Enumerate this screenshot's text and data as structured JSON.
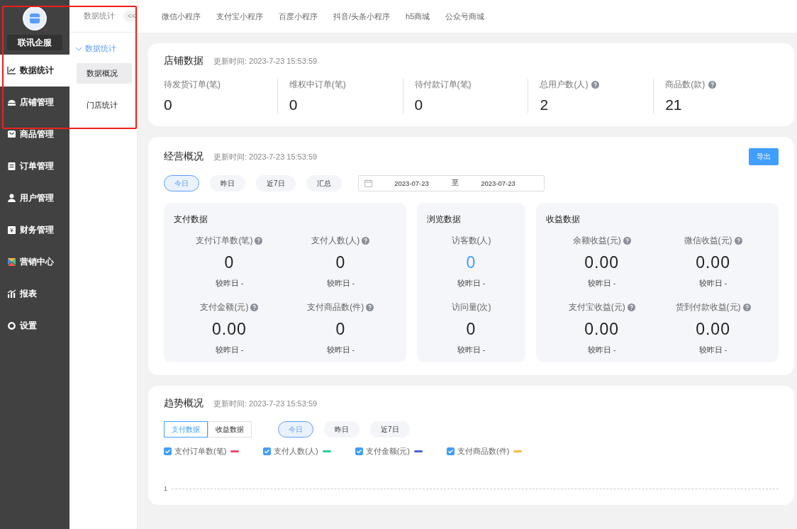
{
  "sidebar": {
    "brand": "联讯企服",
    "items": [
      {
        "label": "数据统计",
        "selected": true
      },
      {
        "label": "店铺管理",
        "selected": false
      },
      {
        "label": "商品管理",
        "selected": false
      },
      {
        "label": "订单管理",
        "selected": false
      },
      {
        "label": "用户管理",
        "selected": false
      },
      {
        "label": "财务管理",
        "selected": false
      },
      {
        "label": "营销中心",
        "selected": false
      },
      {
        "label": "报表",
        "selected": false
      },
      {
        "label": "设置",
        "selected": false
      }
    ]
  },
  "submenu": {
    "title": "数据统计",
    "collapse": "<<",
    "group": {
      "label": "数据统计",
      "expanded": true,
      "children": [
        {
          "label": "数据概况",
          "selected": true
        },
        {
          "label": "门店统计",
          "selected": false
        }
      ]
    }
  },
  "top_tabs": [
    "微信小程序",
    "支付宝小程序",
    "百度小程序",
    "抖音/头条小程序",
    "h5商城",
    "公众号商城"
  ],
  "store_data": {
    "title": "店铺数据",
    "updated": "更新时间: 2023-7-23 15:53:59",
    "metrics": [
      {
        "label": "待发货订单(笔)",
        "value": "0",
        "help": false
      },
      {
        "label": "维权中订单(笔)",
        "value": "0",
        "help": false
      },
      {
        "label": "待付款订单(笔)",
        "value": "0",
        "help": false
      },
      {
        "label": "总用户数(人)",
        "value": "2",
        "help": true
      },
      {
        "label": "商品数(款)",
        "value": "21",
        "help": true
      }
    ]
  },
  "business": {
    "title": "经营概况",
    "updated": "更新时间: 2023-7-23 15:53:59",
    "export": "导出",
    "ranges": [
      {
        "label": "今日",
        "selected": true
      },
      {
        "label": "昨日",
        "selected": false
      },
      {
        "label": "近7日",
        "selected": false
      },
      {
        "label": "汇总",
        "selected": false
      }
    ],
    "date_range": {
      "start": "2023-07-23",
      "separator": "至",
      "end": "2023-07-23"
    },
    "panels": [
      {
        "title": "支付数据",
        "items": [
          {
            "label": "支付订单数(笔)",
            "help": true,
            "value": "0",
            "accent": false,
            "compare": "较昨日 -"
          },
          {
            "label": "支付人数(人)",
            "help": true,
            "value": "0",
            "accent": false,
            "compare": "较昨日 -"
          },
          {
            "label": "支付金额(元)",
            "help": true,
            "value": "0.00",
            "accent": false,
            "compare": "较昨日 -"
          },
          {
            "label": "支付商品数(件)",
            "help": true,
            "value": "0",
            "accent": false,
            "compare": "较昨日 -"
          }
        ]
      },
      {
        "title": "浏览数据",
        "items": [
          {
            "label": "访客数(人)",
            "help": false,
            "value": "0",
            "accent": true,
            "compare": "较昨日 -"
          },
          {
            "label": "访问量(次)",
            "help": false,
            "value": "0",
            "accent": false,
            "compare": "较昨日 -"
          }
        ]
      },
      {
        "title": "收益数据",
        "items": [
          {
            "label": "余额收益(元)",
            "help": true,
            "value": "0.00",
            "accent": false,
            "compare": "较昨日 -"
          },
          {
            "label": "微信收益(元)",
            "help": true,
            "value": "0.00",
            "accent": false,
            "compare": "较昨日 -"
          },
          {
            "label": "支付宝收益(元)",
            "help": true,
            "value": "0.00",
            "accent": false,
            "compare": "较昨日 -"
          },
          {
            "label": "货到付款收益(元)",
            "help": true,
            "value": "0.00",
            "accent": false,
            "compare": "较昨日 -"
          }
        ]
      }
    ]
  },
  "trend": {
    "title": "趋势概况",
    "updated": "更新时间: 2023-7-23 15:53:59",
    "toggles": [
      {
        "label": "支付数据",
        "selected": true
      },
      {
        "label": "收益数据",
        "selected": false
      }
    ],
    "ranges": [
      {
        "label": "今日",
        "selected": true
      },
      {
        "label": "昨日",
        "selected": false
      },
      {
        "label": "近7日",
        "selected": false
      }
    ],
    "legend": [
      {
        "label": "支付订单数(笔)",
        "checked": true,
        "color": "#f5476e"
      },
      {
        "label": "支付人数(人)",
        "checked": true,
        "color": "#2ecca0"
      },
      {
        "label": "支付金额(元)",
        "checked": true,
        "color": "#4d5ee0"
      },
      {
        "label": "支付商品数(件)",
        "checked": true,
        "color": "#fbb93a"
      }
    ],
    "y_tick": "1"
  }
}
